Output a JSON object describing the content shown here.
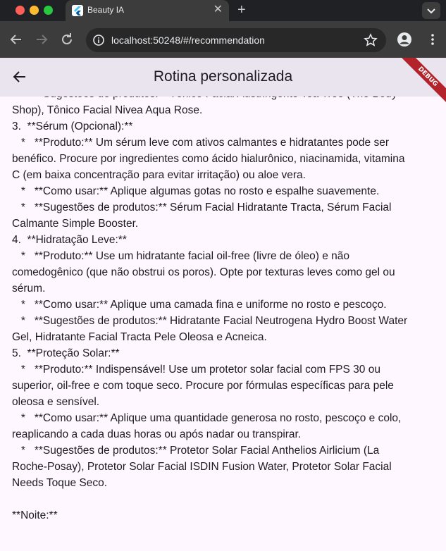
{
  "browser": {
    "tab_title": "Beauty IA",
    "url": "localhost:50248/#/recommendation",
    "icons": {
      "back": "arrow-left-icon",
      "forward": "arrow-right-icon",
      "reload": "reload-icon",
      "info": "info-icon",
      "bookmark": "star-icon",
      "profile": "person-icon",
      "menu": "more-vertical-icon",
      "close_tab": "close-icon",
      "new_tab": "plus-icon",
      "tab_list": "chevron-down-icon"
    }
  },
  "app": {
    "title": "Rotina personalizada",
    "debug_banner": "DEBUG",
    "colors": {
      "appbar_bg": "#eae4ee",
      "page_bg": "#fef7ff",
      "debug_ribbon": "#b3232b"
    }
  },
  "content": {
    "lines": [
      "   *   **Sugestões de produtos:** Tônico Facial Adstringente Tea Tree (The Body",
      "Shop), Tônico Facial Nivea Aqua Rose.",
      "3.  **Sérum (Opcional):**",
      "   *   **Produto:** Um sérum leve com ativos calmantes e hidratantes pode ser",
      "benéfico. Procure por ingredientes como ácido hialurônico, niacinamida, vitamina",
      "C (em baixa concentração para evitar irritação) ou aloe vera.",
      "   *   **Como usar:** Aplique algumas gotas no rosto e espalhe suavemente.",
      "   *   **Sugestões de produtos:** Sérum Facial Hidratante Tracta, Sérum Facial",
      "Calmante Simple Booster.",
      "4.  **Hidratação Leve:**",
      "   *   **Produto:** Use um hidratante facial oil-free (livre de óleo) e não",
      "comedogênico (que não obstrui os poros). Opte por texturas leves como gel ou",
      "sérum.",
      "   *   **Como usar:** Aplique uma camada fina e uniforme no rosto e pescoço.",
      "   *   **Sugestões de produtos:** Hidratante Facial Neutrogena Hydro Boost Water",
      "Gel, Hidratante Facial Tracta Pele Oleosa e Acneica.",
      "5.  **Proteção Solar:**",
      "   *   **Produto:** Indispensável! Use um protetor solar facial com FPS 30 ou",
      "superior, oil-free e com toque seco. Procure por fórmulas específicas para pele",
      "oleosa e sensível.",
      "   *   **Como usar:** Aplique uma quantidade generosa no rosto, pescoço e colo,",
      "reaplicando a cada duas horas ou após nadar ou transpirar.",
      "   *   **Sugestões de produtos:** Protetor Solar Facial Anthelios Airlicium (La",
      "Roche-Posay), Protetor Solar Facial ISDIN Fusion Water, Protetor Solar Facial",
      "Needs Toque Seco.",
      "",
      "**Noite:**"
    ]
  }
}
